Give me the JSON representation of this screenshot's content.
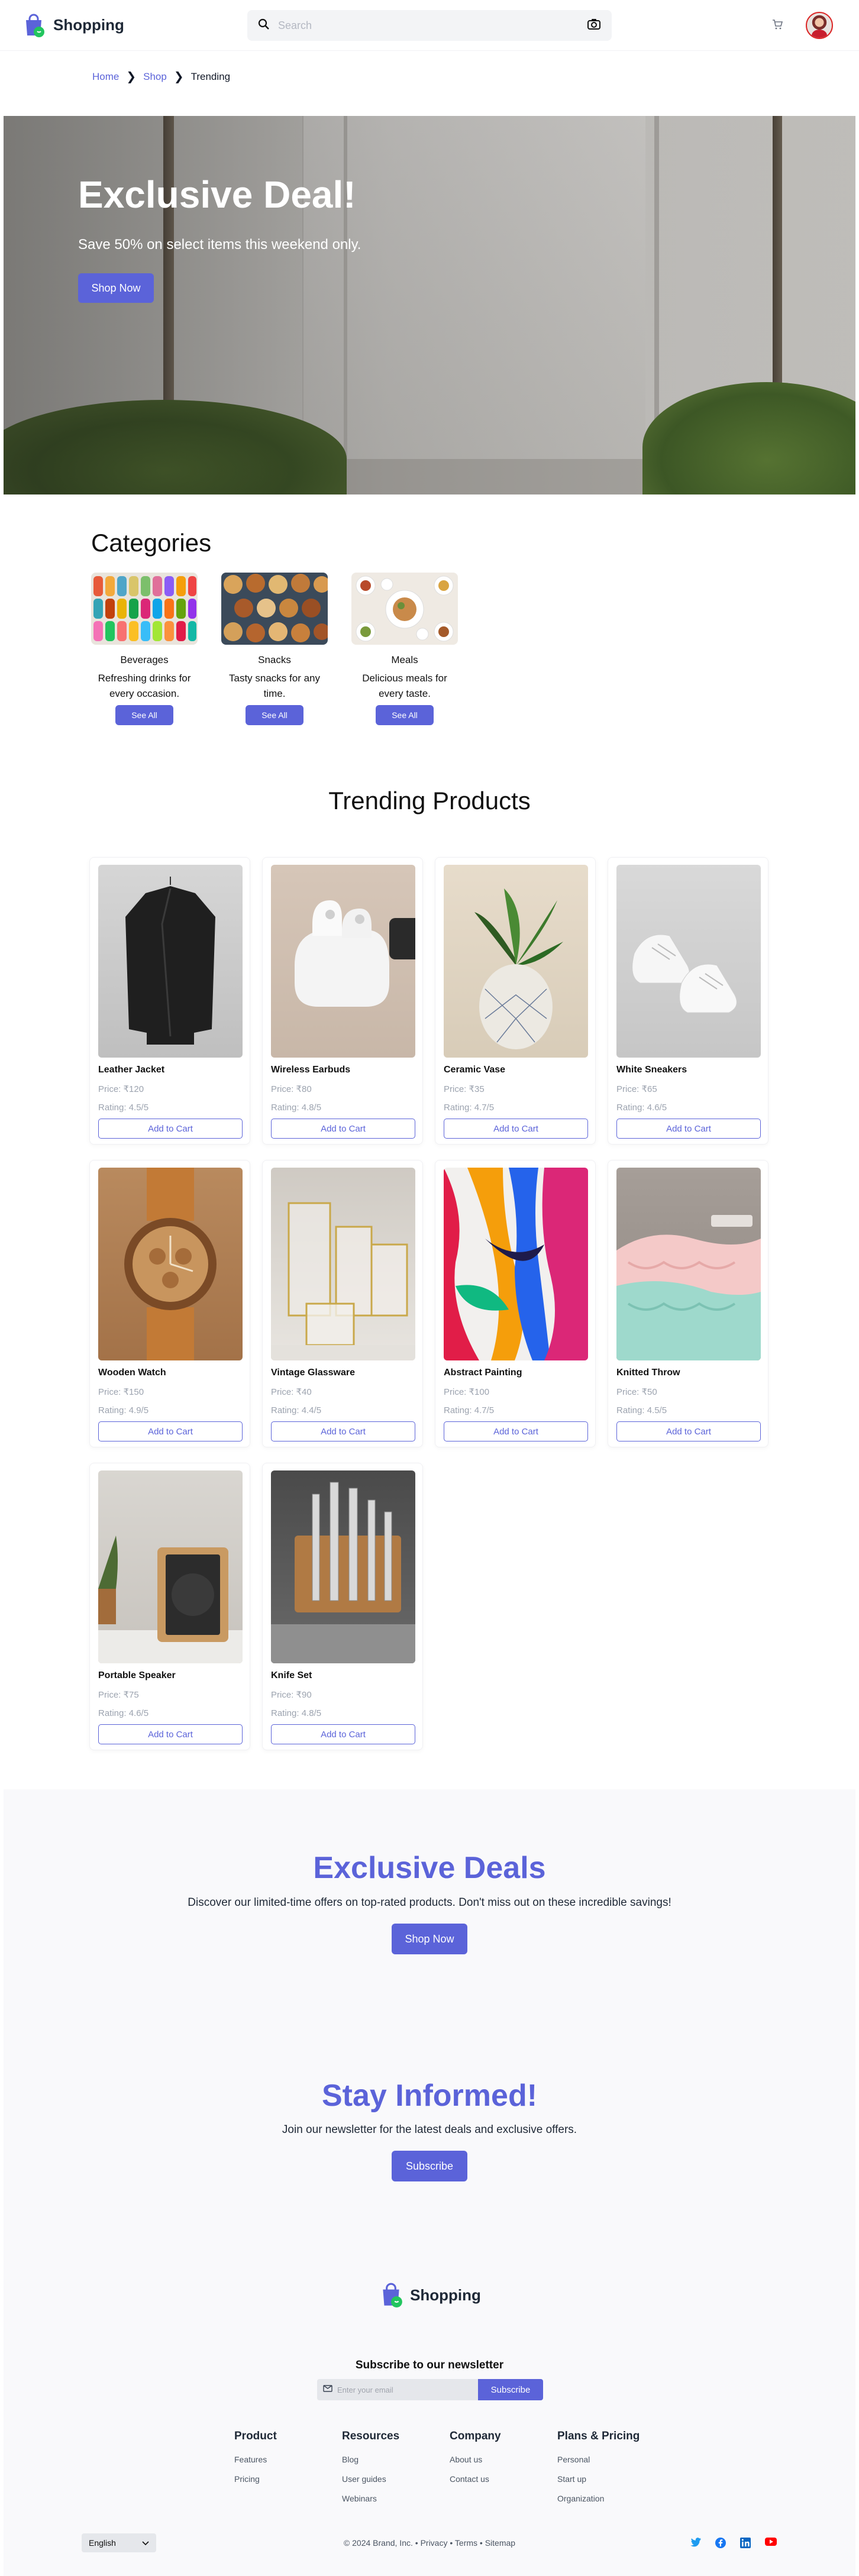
{
  "header": {
    "brand": "Shopping",
    "search_placeholder": "Search"
  },
  "breadcrumb": {
    "home": "Home",
    "shop": "Shop",
    "current": "Trending"
  },
  "hero": {
    "title": "Exclusive Deal!",
    "subtitle": "Save 50% on select items this weekend only.",
    "button": "Shop Now"
  },
  "categories": {
    "title": "Categories",
    "items": [
      {
        "name": "Beverages",
        "desc": "Refreshing drinks for every occasion.",
        "button": "See All"
      },
      {
        "name": "Snacks",
        "desc": "Tasty snacks for any time.",
        "button": "See All"
      },
      {
        "name": "Meals",
        "desc": "Delicious meals for every taste.",
        "button": "See All"
      }
    ]
  },
  "trending": {
    "title": "Trending Products",
    "products": [
      {
        "name": "Leather Jacket",
        "price": "Price: ₹120",
        "rating": "Rating: 4.5/5",
        "button": "Add to Cart"
      },
      {
        "name": "Wireless Earbuds",
        "price": "Price: ₹80",
        "rating": "Rating: 4.8/5",
        "button": "Add to Cart"
      },
      {
        "name": "Ceramic Vase",
        "price": "Price: ₹35",
        "rating": "Rating: 4.7/5",
        "button": "Add to Cart"
      },
      {
        "name": "White Sneakers",
        "price": "Price: ₹65",
        "rating": "Rating: 4.6/5",
        "button": "Add to Cart"
      },
      {
        "name": "Wooden Watch",
        "price": "Price: ₹150",
        "rating": "Rating: 4.9/5",
        "button": "Add to Cart"
      },
      {
        "name": "Vintage Glassware",
        "price": "Price: ₹40",
        "rating": "Rating: 4.4/5",
        "button": "Add to Cart"
      },
      {
        "name": "Abstract Painting",
        "price": "Price: ₹100",
        "rating": "Rating: 4.7/5",
        "button": "Add to Cart"
      },
      {
        "name": "Knitted Throw",
        "price": "Price: ₹50",
        "rating": "Rating: 4.5/5",
        "button": "Add to Cart"
      },
      {
        "name": "Portable Speaker",
        "price": "Price: ₹75",
        "rating": "Rating: 4.6/5",
        "button": "Add to Cart"
      },
      {
        "name": "Knife Set",
        "price": "Price: ₹90",
        "rating": "Rating: 4.8/5",
        "button": "Add to Cart"
      }
    ]
  },
  "deals": {
    "title": "Exclusive Deals",
    "subtitle": "Discover our limited-time offers on top-rated products. Don't miss out on these incredible savings!",
    "button": "Shop Now"
  },
  "informed": {
    "title": "Stay Informed!",
    "subtitle": "Join our newsletter for the latest deals and exclusive offers.",
    "button": "Subscribe"
  },
  "footer": {
    "brand": "Shopping",
    "newsletter_title": "Subscribe to our newsletter",
    "email_placeholder": "Enter your email",
    "subscribe_button": "Subscribe",
    "columns": [
      {
        "title": "Product",
        "links": [
          "Features",
          "Pricing"
        ]
      },
      {
        "title": "Resources",
        "links": [
          "Blog",
          "User guides",
          "Webinars"
        ]
      },
      {
        "title": "Company",
        "links": [
          "About us",
          "Contact us"
        ]
      },
      {
        "title": "Plans & Pricing",
        "links": [
          "Personal",
          "Start up",
          "Organization"
        ]
      }
    ],
    "language": "English",
    "copyright": "© 2024 Brand, Inc.",
    "legal_links": [
      "Privacy",
      "Terms",
      "Sitemap"
    ],
    "social_icons": [
      "twitter-icon",
      "facebook-icon",
      "linkedin-icon",
      "youtube-icon"
    ]
  },
  "colors": {
    "accent": "#5b63d9",
    "text": "#111827",
    "muted": "#9ca3af",
    "band": "#f9f9fb"
  }
}
